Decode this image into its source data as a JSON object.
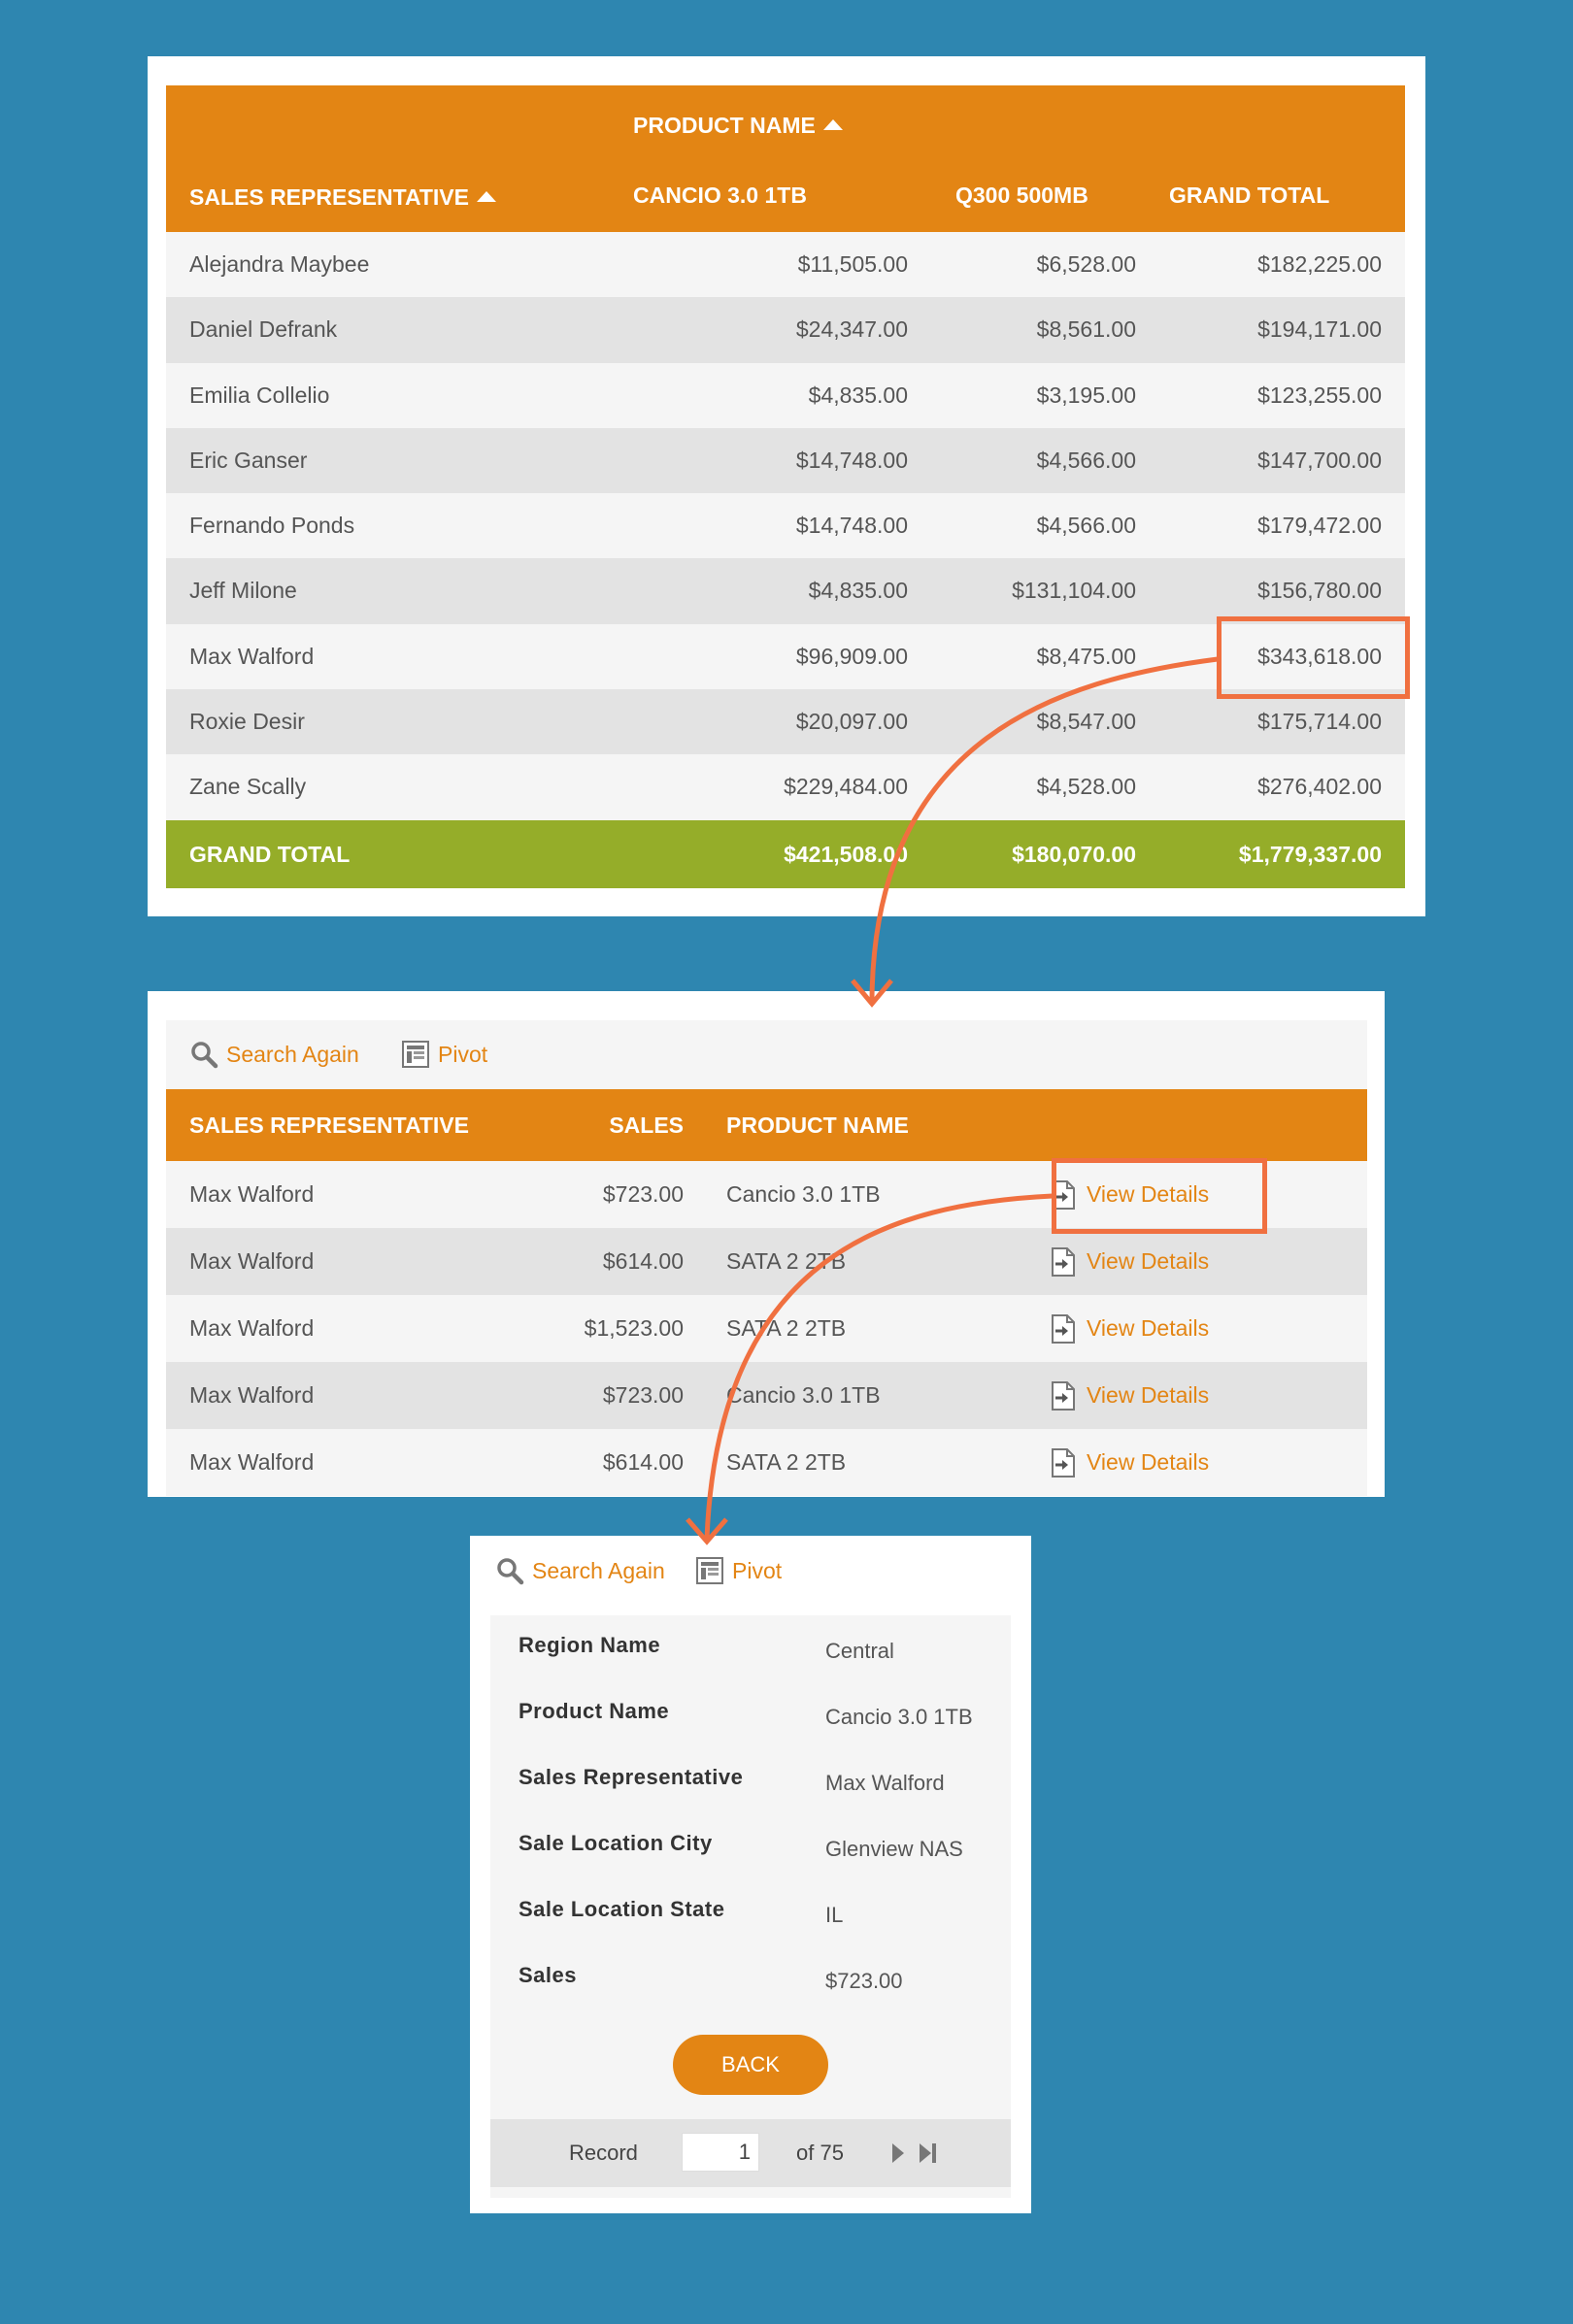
{
  "pivot": {
    "col_group_label": "PRODUCT NAME",
    "row_header": "SALES REPRESENTATIVE",
    "columns": [
      "CANCIO 3.0 1TB",
      "Q300 500MB",
      "GRAND TOTAL"
    ],
    "rows": [
      {
        "name": "Alejandra Maybee",
        "a": "$11,505.00",
        "b": "$6,528.00",
        "total": "$182,225.00"
      },
      {
        "name": "Daniel Defrank",
        "a": "$24,347.00",
        "b": "$8,561.00",
        "total": "$194,171.00"
      },
      {
        "name": "Emilia Collelio",
        "a": "$4,835.00",
        "b": "$3,195.00",
        "total": "$123,255.00"
      },
      {
        "name": "Eric Ganser",
        "a": "$14,748.00",
        "b": "$4,566.00",
        "total": "$147,700.00"
      },
      {
        "name": "Fernando Ponds",
        "a": "$14,748.00",
        "b": "$4,566.00",
        "total": "$179,472.00"
      },
      {
        "name": "Jeff Milone",
        "a": "$4,835.00",
        "b": "$131,104.00",
        "total": "$156,780.00"
      },
      {
        "name": "Max Walford",
        "a": "$96,909.00",
        "b": "$8,475.00",
        "total": "$343,618.00"
      },
      {
        "name": "Roxie Desir",
        "a": "$20,097.00",
        "b": "$8,547.00",
        "total": "$175,714.00"
      },
      {
        "name": "Zane Scally",
        "a": "$229,484.00",
        "b": "$4,528.00",
        "total": "$276,402.00"
      }
    ],
    "grand_total": {
      "label": "GRAND TOTAL",
      "a": "$421,508.00",
      "b": "$180,070.00",
      "total": "$1,779,337.00"
    }
  },
  "toolbar": {
    "search_again": "Search Again",
    "pivot": "Pivot"
  },
  "records": {
    "headers": {
      "rep": "SALES REPRESENTATIVE",
      "sales": "SALES",
      "product": "PRODUCT NAME"
    },
    "view_label": "View Details",
    "rows": [
      {
        "rep": "Max Walford",
        "sales": "$723.00",
        "product": "Cancio 3.0 1TB"
      },
      {
        "rep": "Max Walford",
        "sales": "$614.00",
        "product": "SATA 2 2TB"
      },
      {
        "rep": "Max Walford",
        "sales": "$1,523.00",
        "product": "SATA 2 2TB"
      },
      {
        "rep": "Max Walford",
        "sales": "$723.00",
        "product": "Cancio 3.0 1TB"
      },
      {
        "rep": "Max Walford",
        "sales": "$614.00",
        "product": "SATA 2 2TB"
      }
    ]
  },
  "detail": {
    "fields": [
      {
        "label": "Region Name",
        "value": "Central"
      },
      {
        "label": "Product Name",
        "value": "Cancio 3.0 1TB"
      },
      {
        "label": "Sales Representative",
        "value": "Max Walford"
      },
      {
        "label": "Sale Location City",
        "value": "Glenview NAS"
      },
      {
        "label": "Sale Location State",
        "value": "IL"
      },
      {
        "label": "Sales",
        "value": "$723.00"
      }
    ],
    "back_label": "BACK",
    "pager": {
      "record_label": "Record",
      "current": "1",
      "of_label": "of 75"
    }
  },
  "colors": {
    "background": "#2e86b0",
    "header": "#e38514",
    "total": "#95ad29",
    "callout": "#f07040"
  },
  "icons": [
    "search-icon",
    "pivot-icon",
    "view-details-icon",
    "next-page-icon",
    "last-page-icon",
    "sort-ascending-icon"
  ]
}
